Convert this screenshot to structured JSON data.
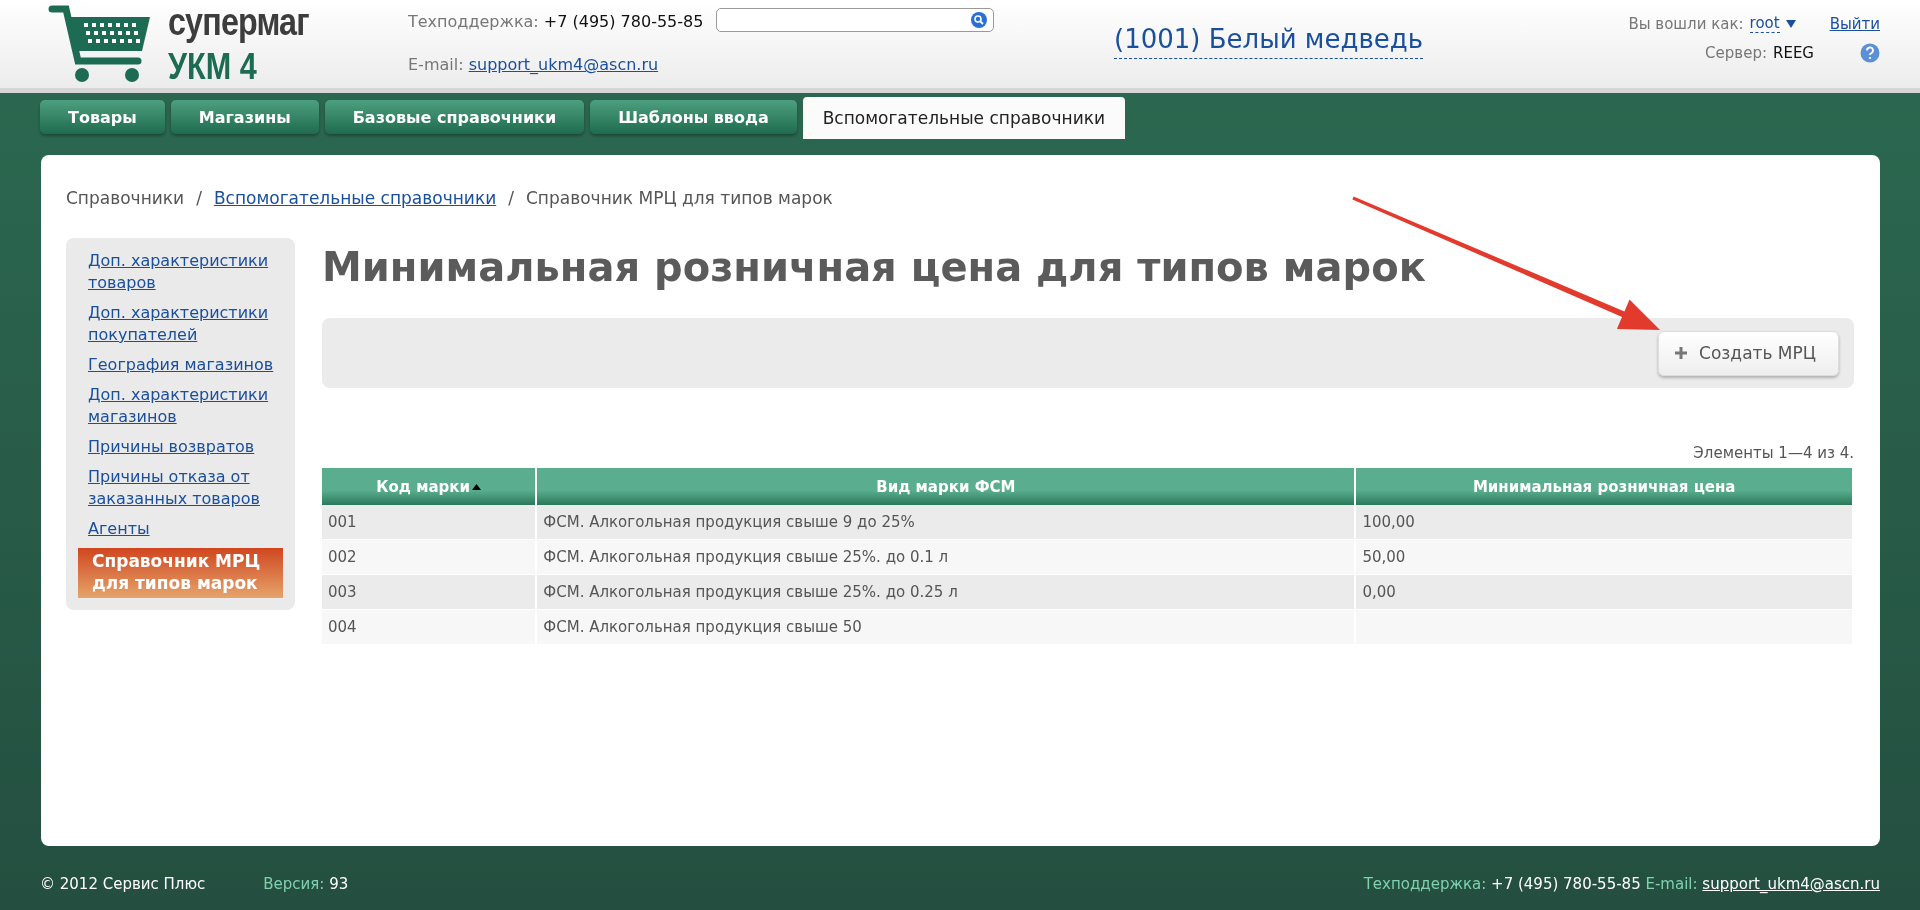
{
  "header": {
    "logo": {
      "line_1": "супермаг",
      "line_2": "УКМ 4"
    },
    "support": {
      "label": "Техподдержка:",
      "phone": "+7 (495) 780-55-85",
      "email_label": "E-mail:",
      "email": "support_ukm4@ascn.ru"
    },
    "store": "(1001) Белый медведь",
    "user": {
      "label": "Вы вошли как:",
      "name": "root",
      "logout": "Выйти",
      "server_label": "Сервер:",
      "server": "REEG"
    }
  },
  "tabs": [
    {
      "label": "Товары",
      "selected": false
    },
    {
      "label": "Магазины",
      "selected": false
    },
    {
      "label": "Базовые справочники",
      "selected": false
    },
    {
      "label": "Шаблоны ввода",
      "selected": false
    },
    {
      "label": "Вспомогательные справочники",
      "selected": true
    }
  ],
  "breadcrumb": [
    {
      "label": "Справочники",
      "link": false
    },
    {
      "label": "Вспомогательные справочники",
      "link": true
    },
    {
      "label": "Справочник МРЦ для типов марок",
      "link": false
    }
  ],
  "breadcrumb_separator": "/",
  "sidebar": {
    "items": [
      {
        "label": "Доп. характеристики товаров",
        "selected": false
      },
      {
        "label": "Доп. характеристики покупателей",
        "selected": false
      },
      {
        "label": "География магазинов",
        "selected": false
      },
      {
        "label": "Доп. характеристики магазинов",
        "selected": false
      },
      {
        "label": "Причины возвратов",
        "selected": false
      },
      {
        "label": "Причины отказа от заказанных товаров",
        "selected": false
      },
      {
        "label": "Агенты",
        "selected": false
      },
      {
        "label": "Справочник МРЦ для типов марок",
        "selected": true
      }
    ]
  },
  "page_title": "Минимальная розничная цена для типов марок",
  "toolbar": {
    "create_button": "Создать МРЦ"
  },
  "annotations": [
    {
      "kind": "arrow"
    }
  ],
  "table": {
    "summary": "Элементы 1—4 из 4.",
    "columns": [
      {
        "label": "Код марки",
        "sorted": true
      },
      {
        "label": "Вид марки ФСМ",
        "sorted": false
      },
      {
        "label": "Минимальная розничная цена",
        "sorted": false
      }
    ],
    "rows": [
      [
        "001",
        "ФСМ. Алкогольная продукция свыше 9 до 25%",
        "100,00"
      ],
      [
        "002",
        "ФСМ. Алкогольная продукция свыше 25%. до 0.1 л",
        "50,00"
      ],
      [
        "003",
        "ФСМ. Алкогольная продукция свыше 25%. до 0.25 л",
        "0,00"
      ],
      [
        "004",
        "ФСМ. Алкогольная продукция свыше 50",
        ""
      ]
    ]
  },
  "footer": {
    "copyright": "© 2012 Сервис Плюс",
    "version_label": "Версия:",
    "version": "93",
    "support_label": "Техподдержка:",
    "phone": "+7 (495) 780-55-85",
    "email_label": "E-mail:",
    "email": "support_ukm4@ascn.ru"
  }
}
